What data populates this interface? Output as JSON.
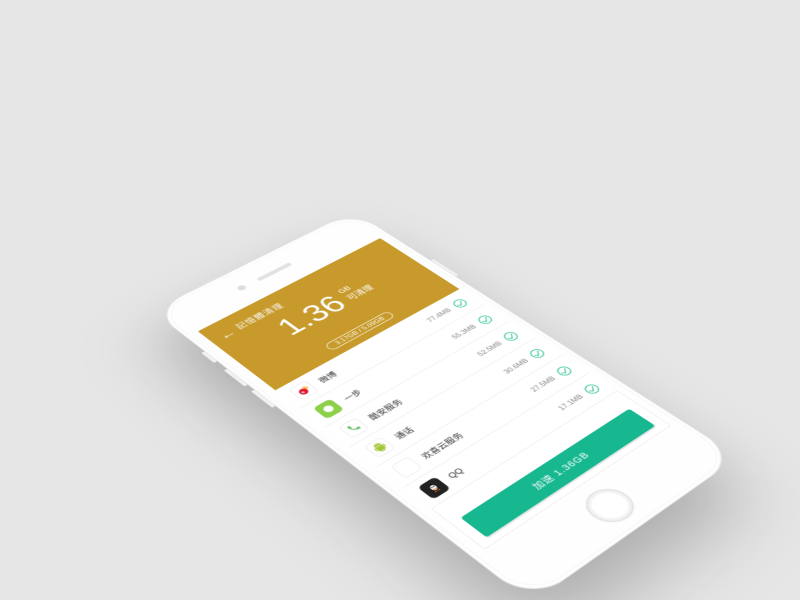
{
  "header": {
    "title": "記憶體清理",
    "amount": "1.36",
    "unit": "GB",
    "subtitle": "可清理",
    "usage": "3.17GB / 5.09GB"
  },
  "apps": [
    {
      "name": "微博",
      "size": "77.4MB",
      "icon": "weibo"
    },
    {
      "name": "一步",
      "size": "55.3MB",
      "icon": "green"
    },
    {
      "name": "酷安服务",
      "size": "52.5MB",
      "icon": "call"
    },
    {
      "name": "通话",
      "size": "30.6MB",
      "icon": "android"
    },
    {
      "name": "欢喜云服务",
      "size": "27.5MB",
      "icon": "cloud"
    },
    {
      "name": "QQ",
      "size": "17.1MB",
      "icon": "qq"
    }
  ],
  "action": {
    "label": "加速 1.36GB"
  },
  "colors": {
    "accent": "#17b890",
    "header": "#c79a2b"
  }
}
